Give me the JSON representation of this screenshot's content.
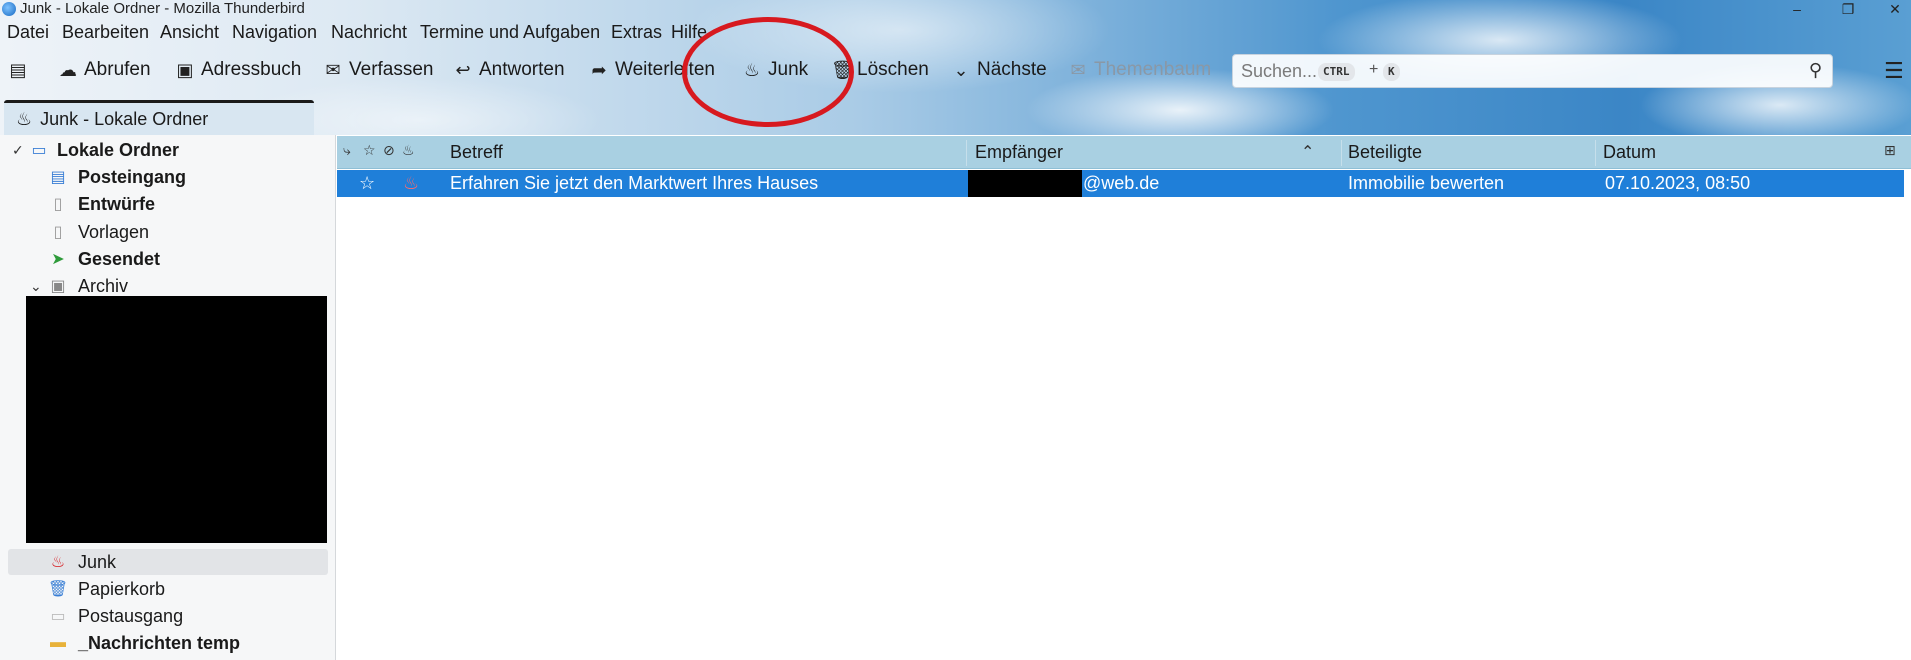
{
  "window": {
    "title": "Junk - Lokale Ordner - Mozilla Thunderbird",
    "minimize": "–",
    "restore": "❐",
    "close": "✕"
  },
  "menu": [
    "Datei",
    "Bearbeiten",
    "Ansicht",
    "Navigation",
    "Nachricht",
    "Termine und Aufgaben",
    "Extras",
    "Hilfe"
  ],
  "toolbar": {
    "folder_pane_icon": "sidebar-icon",
    "buttons": [
      {
        "label": "Abrufen",
        "icon": "☁"
      },
      {
        "label": "Adressbuch",
        "icon": "▣"
      },
      {
        "label": "Verfassen",
        "icon": "✉"
      },
      {
        "label": "Antworten",
        "icon": "↩"
      },
      {
        "label": "Weiterleiten",
        "icon": "➦"
      },
      {
        "label": "Junk",
        "icon": "♨"
      },
      {
        "label": "Löschen",
        "icon": "🗑"
      },
      {
        "label": "Nächste",
        "icon": "⌄"
      },
      {
        "label": "Themenbaum",
        "icon": "✉"
      }
    ]
  },
  "search": {
    "placeholder": "Suchen...",
    "shortcut_key1": "CTRL",
    "shortcut_plus": "+",
    "shortcut_key2": "K",
    "icon": "⚲"
  },
  "tab": {
    "label": "Junk - Lokale Ordner",
    "icon": "♨"
  },
  "folders": {
    "root": "Lokale Ordner",
    "items": [
      {
        "label": "Posteingang",
        "bold": true,
        "icon": "📥"
      },
      {
        "label": "Entwürfe",
        "bold": true,
        "icon": "📄"
      },
      {
        "label": "Vorlagen",
        "bold": false,
        "icon": "📄"
      },
      {
        "label": "Gesendet",
        "bold": true,
        "icon": "➤"
      },
      {
        "label": "Archiv",
        "bold": false,
        "icon": "🗄"
      },
      {
        "label": "Junk",
        "bold": false,
        "icon": "♨"
      },
      {
        "label": "Papierkorb",
        "bold": false,
        "icon": "🗑"
      },
      {
        "label": "Postausgang",
        "bold": false,
        "icon": "✉"
      },
      {
        "label": "_Nachrichten temp",
        "bold": true,
        "icon": "📁"
      }
    ]
  },
  "columns": {
    "subject": "Betreff",
    "recipient": "Empfänger",
    "participants": "Beteiligte",
    "date": "Datum"
  },
  "messages": [
    {
      "subject": "Erfahren Sie jetzt den Marktwert Ihres Hauses",
      "recipient_suffix": "@web.de",
      "participants": "Immobilie bewerten",
      "date": "07.10.2023, 08:50"
    }
  ],
  "colors": {
    "selection": "#1f7fd9",
    "header_row": "#a9d0e2",
    "annotation": "#d7191f"
  }
}
